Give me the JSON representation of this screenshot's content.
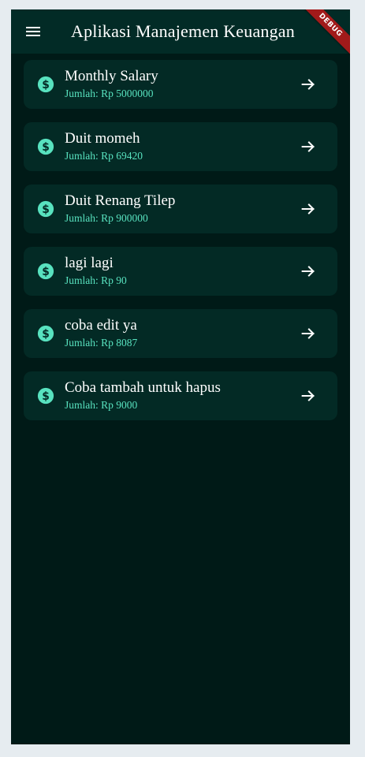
{
  "appbar": {
    "title": "Aplikasi Manajemen Keuangan",
    "menu_icon": "menu-icon",
    "debug_label": "DEBUG"
  },
  "colors": {
    "background": "#001a17",
    "appbar": "#022b26",
    "card": "#032a25",
    "accent": "#58e2bf",
    "debug_banner": "#a11a1a"
  },
  "items": [
    {
      "title": "Monthly Salary",
      "subtitle": "Jumlah: Rp 5000000",
      "icon": "dollar-circle-icon",
      "action_icon": "arrow-right-icon"
    },
    {
      "title": "Duit momeh",
      "subtitle": "Jumlah: Rp 69420",
      "icon": "dollar-circle-icon",
      "action_icon": "arrow-right-icon"
    },
    {
      "title": "Duit Renang Tilep",
      "subtitle": "Jumlah: Rp 900000",
      "icon": "dollar-circle-icon",
      "action_icon": "arrow-right-icon"
    },
    {
      "title": "lagi lagi",
      "subtitle": "Jumlah: Rp 90",
      "icon": "dollar-circle-icon",
      "action_icon": "arrow-right-icon"
    },
    {
      "title": "coba edit ya",
      "subtitle": "Jumlah: Rp 8087",
      "icon": "dollar-circle-icon",
      "action_icon": "arrow-right-icon"
    },
    {
      "title": "Coba tambah untuk hapus",
      "subtitle": "Jumlah: Rp 9000",
      "icon": "dollar-circle-icon",
      "action_icon": "arrow-right-icon"
    }
  ]
}
